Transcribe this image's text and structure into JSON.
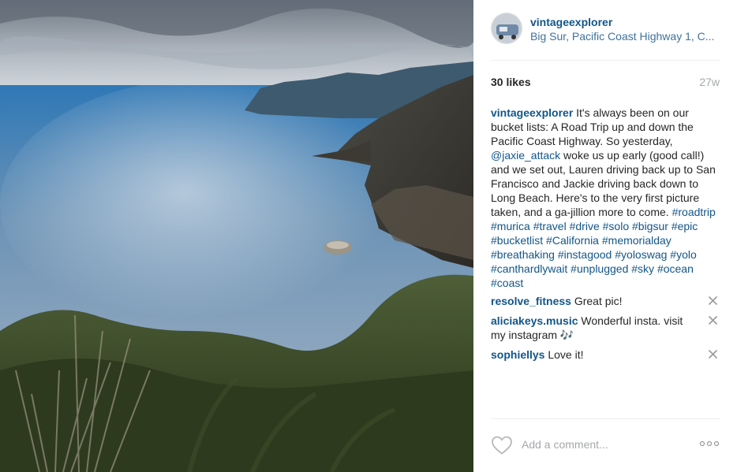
{
  "post": {
    "username": "vintageexplorer",
    "location": "Big Sur, Pacific Coast Highway 1, C...",
    "likes": "30 likes",
    "age": "27w"
  },
  "caption": {
    "author": "vintageexplorer",
    "text_1": " It's always been on our bucket lists: A Road Trip up and down the Pacific Coast Highway. So yesterday, ",
    "mention": "@jaxie_attack",
    "text_2": " woke us up early (good call!) and we set out, Lauren driving back up to San Francisco and Jackie driving back down to Long Beach. Here's to the very first picture taken, and a ga-jillion more to come. ",
    "hashtags": [
      "#roadtrip",
      "#murica",
      "#travel",
      "#drive",
      "#solo",
      "#bigsur",
      "#epic",
      "#bucketlist",
      "#California",
      "#memorialday",
      "#breathaking",
      "#instagood",
      "#yoloswag",
      "#yolo",
      "#canthardlywait",
      "#unplugged",
      "#sky",
      "#ocean",
      "#coast"
    ]
  },
  "comments": [
    {
      "author": "resolve_fitness",
      "text": " Great pic!"
    },
    {
      "author": "aliciakeys.music",
      "text": " Wonderful insta. visit my instagram 🎶"
    },
    {
      "author": "sophiellys",
      "text": " Love it!"
    }
  ],
  "footer": {
    "add_comment_placeholder": "Add a comment..."
  },
  "icons": {
    "like": "heart-outline-icon",
    "remove": "close-icon",
    "more": "ellipsis-icon"
  },
  "colors": {
    "username": "#125688",
    "location": "#3f729b",
    "muted": "#a5a7aa",
    "divider": "#efefef"
  }
}
